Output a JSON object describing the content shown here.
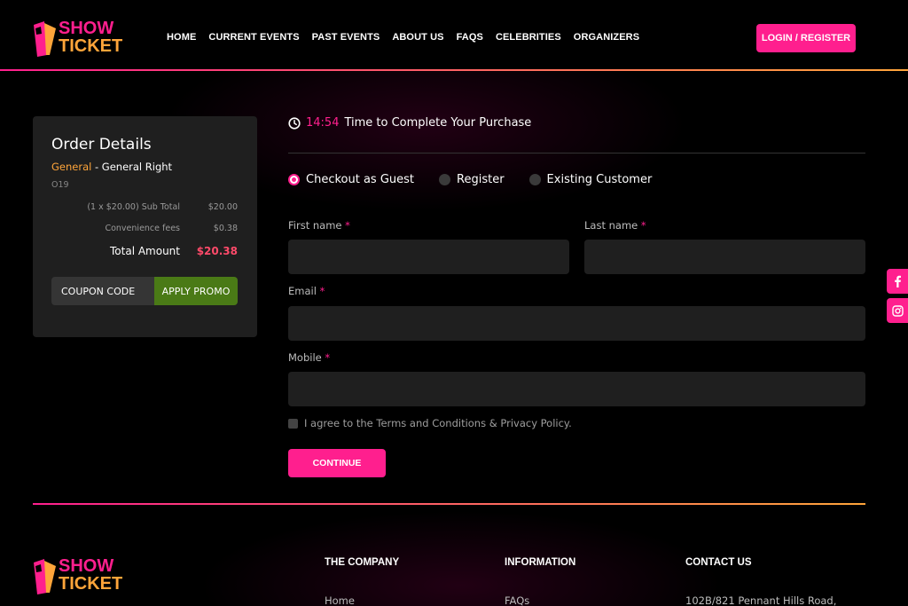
{
  "brand": {
    "word1": "SHOW",
    "word2": "TICKET",
    "pink": "#ff1f8e",
    "orange": "#ffa53a"
  },
  "nav": {
    "items": [
      "HOME",
      "CURRENT EVENTS",
      "PAST EVENTS",
      "ABOUT US",
      "FAQS",
      "CELEBRITIES",
      "ORGANIZERS"
    ],
    "login_label": "LOGIN / REGISTER"
  },
  "order": {
    "title": "Order Details",
    "ticket_type": "General",
    "ticket_separator": " - ",
    "ticket_name": "General Right",
    "code": "O19",
    "subtotal_label": "(1 x $20.00) Sub Total",
    "subtotal_value": "$20.00",
    "fees_label": "Convenience fees",
    "fees_value": "$0.38",
    "total_label": "Total Amount",
    "total_value": "$20.38",
    "coupon_placeholder": "COUPON CODE",
    "apply_label": "APPLY PROMO"
  },
  "checkout": {
    "timer_value": "14:54",
    "timer_text": "Time to Complete Your Purchase",
    "options": [
      "Checkout as Guest",
      "Register",
      "Existing Customer"
    ],
    "first_name_label": "First name",
    "last_name_label": "Last name",
    "email_label": "Email",
    "mobile_label": "Mobile",
    "required_mark": "*",
    "agree_text": "I agree to the Terms and Conditions & Privacy Policy.",
    "continue_label": "CONTINUE"
  },
  "social": [
    "facebook-icon",
    "instagram-icon"
  ],
  "footer": {
    "col1_title": "THE COMPANY",
    "col1_item": "Home",
    "col2_title": "INFORMATION",
    "col2_item": "FAQs",
    "col3_title": "CONTACT US",
    "col3_item": "102B/821 Pennant Hills Road,"
  }
}
